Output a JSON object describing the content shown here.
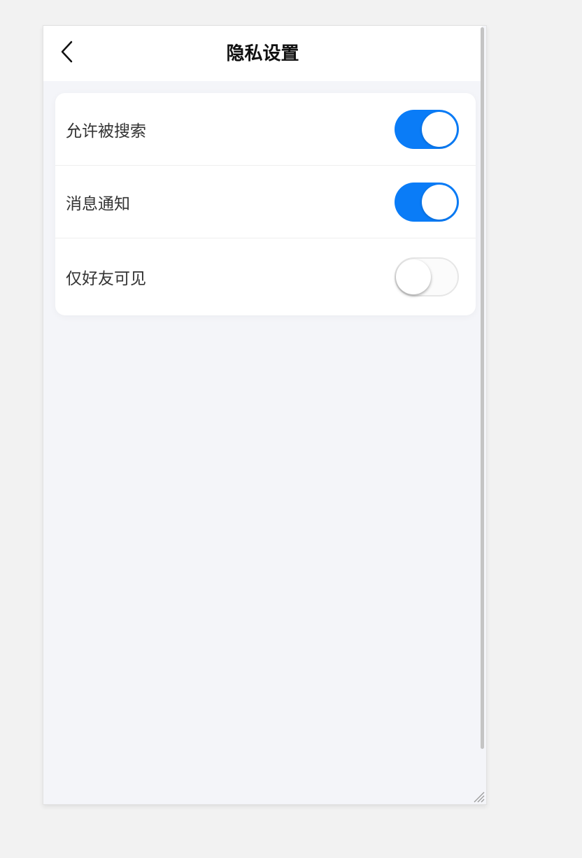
{
  "header": {
    "back_icon": "chevron-left-icon",
    "title": "隐私设置"
  },
  "settings": {
    "items": [
      {
        "label": "允许被搜索",
        "enabled": true
      },
      {
        "label": "消息通知",
        "enabled": true
      },
      {
        "label": "仅好友可见",
        "enabled": false
      }
    ]
  },
  "colors": {
    "accent": "#0a7cf7",
    "background": "#f4f5f9",
    "card": "#ffffff"
  }
}
